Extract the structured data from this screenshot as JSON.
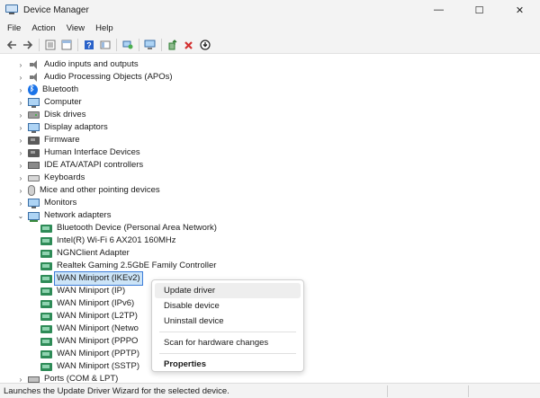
{
  "window": {
    "title": "Device Manager",
    "controls": {
      "minimize": "—",
      "maximize": "☐",
      "close": "✕"
    }
  },
  "menu": [
    "File",
    "Action",
    "View",
    "Help"
  ],
  "toolbar": {
    "buttons": [
      "back-icon",
      "forward-icon",
      "tree-view-icon",
      "properties-icon",
      "help-icon",
      "show-hide-icon",
      "scan-icon",
      "monitor-icon",
      "update-driver-icon",
      "uninstall-icon",
      "disable-icon"
    ]
  },
  "tree": {
    "categories": [
      {
        "label": "Audio inputs and outputs",
        "icon": "speaker-icon"
      },
      {
        "label": "Audio Processing Objects (APOs)",
        "icon": "speaker-icon"
      },
      {
        "label": "Bluetooth",
        "icon": "bluetooth-icon"
      },
      {
        "label": "Computer",
        "icon": "computer-icon"
      },
      {
        "label": "Disk drives",
        "icon": "disk-icon"
      },
      {
        "label": "Display adaptors",
        "icon": "display-icon"
      },
      {
        "label": "Firmware",
        "icon": "chip-icon"
      },
      {
        "label": "Human Interface Devices",
        "icon": "hid-icon"
      },
      {
        "label": "IDE ATA/ATAPI controllers",
        "icon": "ide-icon"
      },
      {
        "label": "Keyboards",
        "icon": "keyboard-icon"
      },
      {
        "label": "Mice and other pointing devices",
        "icon": "mouse-icon"
      },
      {
        "label": "Monitors",
        "icon": "monitor-icon"
      },
      {
        "label": "Network adapters",
        "icon": "network-icon",
        "expanded": true
      }
    ],
    "network_adapters": [
      "Bluetooth Device (Personal Area Network)",
      "Intel(R) Wi-Fi 6 AX201 160MHz",
      "NGNClient Adapter",
      "Realtek Gaming 2.5GbE Family Controller",
      "WAN Miniport (IKEv2)",
      "WAN Miniport (IP)",
      "WAN Miniport (IPv6)",
      "WAN Miniport (L2TP)",
      "WAN Miniport (Netwo",
      "WAN Miniport (PPPO",
      "WAN Miniport (PPTP)",
      "WAN Miniport (SSTP)"
    ],
    "selected_adapter": "WAN Miniport (IKEv2)",
    "after": [
      {
        "label": "Ports (COM & LPT)",
        "icon": "port-icon"
      }
    ]
  },
  "context_menu": {
    "items": [
      "Update driver",
      "Disable device",
      "Uninstall device",
      "Scan for hardware changes",
      "Properties"
    ],
    "highlighted": "Update driver",
    "default": "Properties"
  },
  "status": {
    "text": "Launches the Update Driver Wizard for the selected device."
  }
}
